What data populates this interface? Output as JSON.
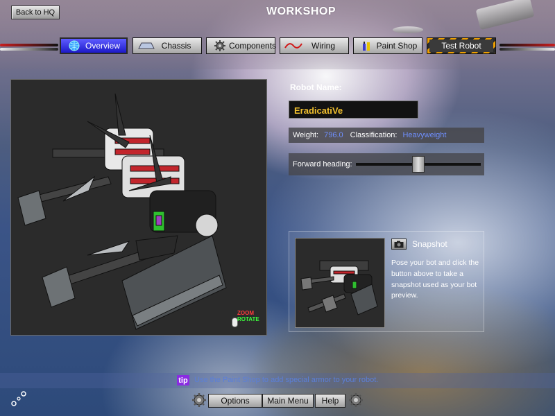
{
  "header": {
    "back_label": "Back to HQ",
    "title": "WORKSHOP"
  },
  "tabs": [
    {
      "label": "Overview",
      "icon": "globe-icon",
      "active": true
    },
    {
      "label": "Chassis",
      "icon": "chassis-icon",
      "active": false
    },
    {
      "label": "Components",
      "icon": "gear-icon",
      "active": false
    },
    {
      "label": "Wiring",
      "icon": "wire-icon",
      "active": false
    },
    {
      "label": "Paint Shop",
      "icon": "paint-icon",
      "active": false
    },
    {
      "label": "Test Robot",
      "icon": "",
      "active": false
    }
  ],
  "viewport": {
    "zoom_hint": "ZOOM",
    "rotate_hint": "ROTATE"
  },
  "robot": {
    "name_label": "Robot Name:",
    "name": "EradicatiVe",
    "weight_label": "Weight:",
    "weight": "796.0",
    "class_label": "Classification:",
    "classification": "Heavyweight",
    "heading_label": "Forward heading:",
    "heading_value": 0.5
  },
  "snapshot": {
    "title": "Snapshot",
    "text": "Pose your bot and click the button above to take a snapshot used as your bot preview."
  },
  "tip": {
    "badge": "tip",
    "text": "Use the Paint Shop to add special armor to your robot."
  },
  "footer": {
    "options_label": "Options",
    "main_menu_label": "Main Menu",
    "help_label": "Help"
  },
  "colors": {
    "active_tab": "#2a27e0",
    "name_text": "#f2c12e",
    "stat_value": "#6f8fff",
    "tip_badge": "#8a2be2"
  }
}
